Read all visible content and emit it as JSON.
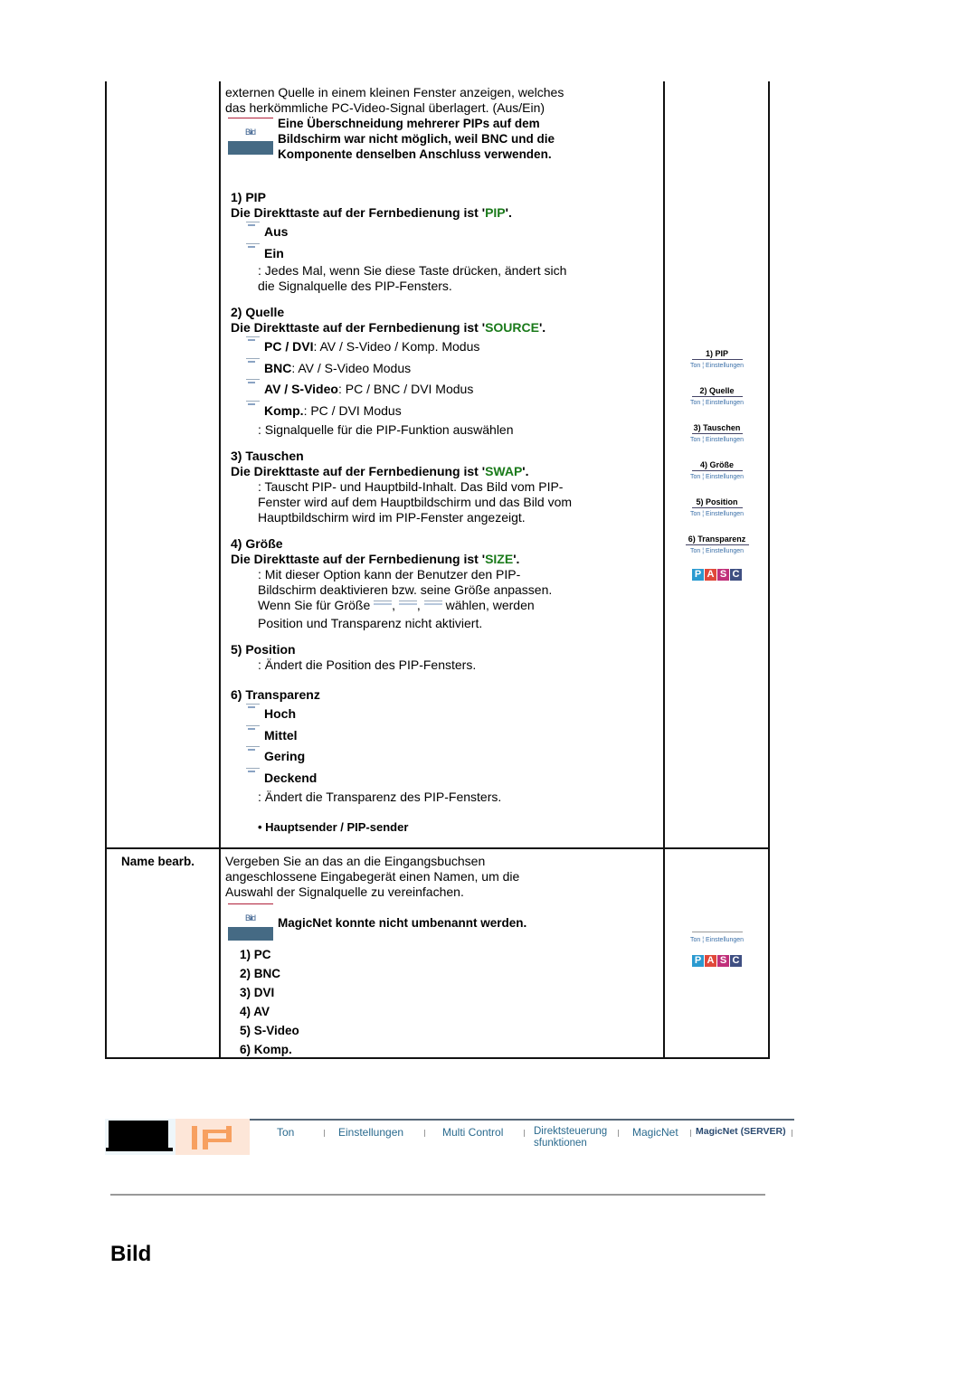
{
  "intro": {
    "lines": [
      "externen Quelle in einem kleinen Fenster anzeigen, welches",
      "das herkömmliche PC-Video-Signal überlagert. (Aus/Ein)"
    ]
  },
  "note_icon_label": "Bild",
  "note1": [
    "Eine Überschneidung mehrerer PIPs auf dem",
    "Bildschirm war nicht möglich, weil BNC und die",
    "Komponente denselben Anschluss verwenden."
  ],
  "pip": {
    "heading": "1) PIP",
    "key_prefix": "Die Direkttaste auf der Fernbedienung ist '",
    "key": "PIP",
    "key_suffix": "'.",
    "options": [
      "Aus",
      "Ein"
    ],
    "desc": [
      ": Jedes Mal, wenn Sie diese Taste drücken, ändert sich",
      "die Signalquelle des PIP-Fensters."
    ]
  },
  "source": {
    "heading": "2) Quelle",
    "key_prefix": "Die Direkttaste auf der Fernbedienung ist '",
    "key": "SOURCE",
    "key_suffix": "'.",
    "options": [
      {
        "bold": "PC / DVI",
        "rest": ": AV / S-Video / Komp. Modus"
      },
      {
        "bold": "BNC",
        "rest": ": AV / S-Video Modus"
      },
      {
        "bold": "AV / S-Video",
        "rest": ": PC / BNC / DVI Modus"
      },
      {
        "bold": "Komp.",
        "rest": ": PC / DVI Modus"
      }
    ],
    "desc": ": Signalquelle für die PIP-Funktion auswählen"
  },
  "swap": {
    "heading": "3) Tauschen",
    "key_prefix": "Die Direkttaste auf der Fernbedienung ist '",
    "key": "SWAP",
    "key_suffix": "'.",
    "desc": [
      ": Tauscht PIP- und Hauptbild-Inhalt. Das Bild vom PIP-",
      "Fenster wird auf dem Hauptbildschirm und das Bild vom",
      "Hauptbildschirm wird im PIP-Fenster angezeigt."
    ]
  },
  "size": {
    "heading": "4) Größe",
    "key_prefix": "Die Direkttaste auf der Fernbedienung ist '",
    "key": "SIZE",
    "key_suffix": "'.",
    "desc": [
      ": Mit dieser Option kann der Benutzer den PIP-",
      "Bildschirm deaktivieren bzw. seine Größe anpassen."
    ],
    "desc_inline_prefix": "Wenn Sie für Größe",
    "desc_inline_suffix": "wählen, werden",
    "desc_last": "Position und Transparenz nicht aktiviert."
  },
  "position": {
    "heading": "5) Position",
    "desc": ": Ändert die Position des PIP-Fensters."
  },
  "transparency": {
    "heading": "6) Transparenz",
    "options": [
      "Hoch",
      "Mittel",
      "Gering",
      "Deckend"
    ],
    "desc": ": Ändert die Transparenz des PIP-Fensters.",
    "bullet": "• Hauptsender / PIP-sender"
  },
  "rename": {
    "label": "Name bearb.",
    "desc": [
      "Vergeben Sie an das an die Eingangsbuchsen",
      "angeschlossene Eingabegerät einen Namen, um die",
      "Auswahl der Signalquelle zu vereinfachen."
    ],
    "note": "MagicNet konnte nicht umbenannt werden.",
    "items": [
      "1) PC",
      "2) BNC",
      "3) DVI",
      "4) AV",
      "5) S-Video",
      "6) Komp."
    ]
  },
  "side_links": [
    "1) PIP",
    "2) Quelle",
    "3) Tauschen",
    "4) Größe",
    "5) Position",
    "6) Transparenz"
  ],
  "side_sub": {
    "a": "Ton",
    "b": "Einstellungen"
  },
  "pasc": {
    "letters": [
      "P",
      "A",
      "S",
      "C"
    ],
    "colors": [
      "#2b9ad0",
      "#e0483a",
      "#c0307a",
      "#3f4f82"
    ]
  },
  "nav": {
    "items": [
      "Ton",
      "Einstellungen",
      "Multi Control",
      "Direktsteuerung sfunktionen",
      "MagicNet",
      "MagicNet (SERVER)"
    ]
  },
  "page_title": "Bild"
}
